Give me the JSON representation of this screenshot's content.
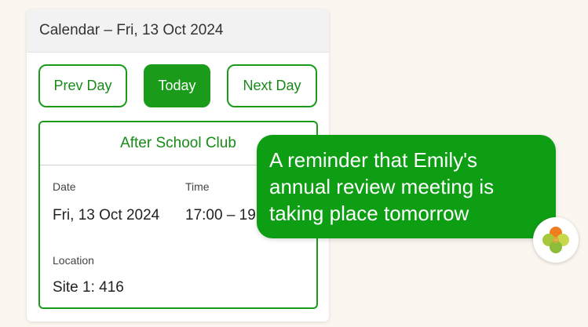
{
  "calendar": {
    "title": "Calendar – Fri, 13 Oct 2024",
    "buttons": {
      "prev": "Prev Day",
      "today": "Today",
      "next": "Next Day"
    },
    "event": {
      "title": "After School Club",
      "date_label": "Date",
      "date_value": "Fri, 13 Oct 2024",
      "time_label": "Time",
      "time_value": "17:00 – 19:00",
      "location_label": "Location",
      "location_value": "Site 1: 416"
    }
  },
  "notification": {
    "message": "A reminder that Emily's annual review meeting is taking place tomorrow"
  },
  "colors": {
    "accent": "#1a9c1a",
    "bubble": "#0e9e14",
    "background": "#fbf6ef"
  },
  "icons": {
    "avatar": "clover-logo-icon"
  }
}
